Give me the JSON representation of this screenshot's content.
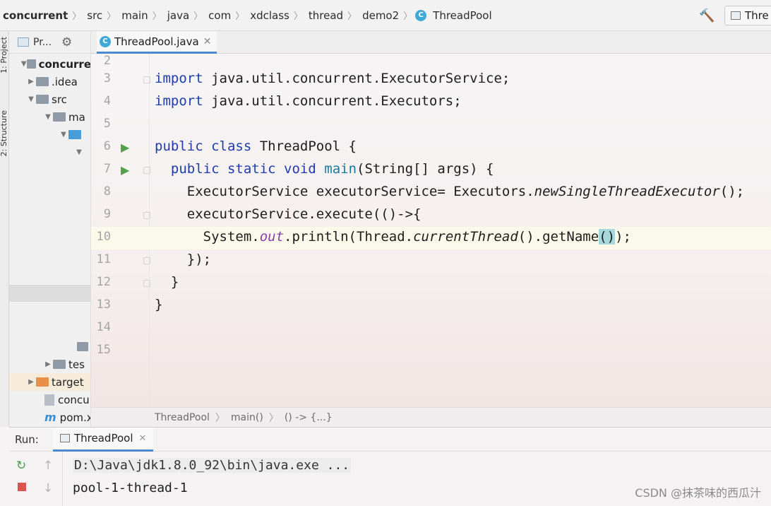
{
  "breadcrumb": [
    "concurrent",
    "src",
    "main",
    "java",
    "com",
    "xdclass",
    "thread",
    "demo2",
    "ThreadPool"
  ],
  "run_config": {
    "label": "Thre"
  },
  "tool_strip": {
    "project_tab": "1: Project",
    "structure_tab": "2: Structure"
  },
  "project_panel": {
    "header": "Pr...",
    "tree": [
      {
        "label": "concurre",
        "icon": "folder-icon",
        "arrow": "▼"
      },
      {
        "label": ".idea",
        "icon": "folder-icon",
        "arrow": "▶"
      },
      {
        "label": "src",
        "icon": "folder-icon",
        "arrow": "▼"
      },
      {
        "label": "ma",
        "icon": "folder-icon",
        "arrow": "▼"
      },
      {
        "label": "",
        "icon": "folder-blue-icon",
        "arrow": "▼"
      },
      {
        "label": "",
        "icon": "",
        "arrow": "▼"
      },
      {
        "label": "",
        "icon": "folder-icon",
        "arrow": ""
      },
      {
        "label": "tes",
        "icon": "folder-icon",
        "arrow": "▶"
      },
      {
        "label": "target",
        "icon": "folder-orange-icon",
        "arrow": "▶"
      },
      {
        "label": "concu",
        "icon": "file-icon",
        "arrow": ""
      },
      {
        "label": "pom.x",
        "icon": "maven-icon",
        "arrow": ""
      }
    ]
  },
  "editor": {
    "tab_label": "ThreadPool.java",
    "current_line": "10",
    "lines": [
      {
        "num": "2"
      },
      {
        "num": "3"
      },
      {
        "num": "4"
      },
      {
        "num": "5"
      },
      {
        "num": "6"
      },
      {
        "num": "7"
      },
      {
        "num": "8"
      },
      {
        "num": "9"
      },
      {
        "num": "10"
      },
      {
        "num": "11"
      },
      {
        "num": "12"
      },
      {
        "num": "13"
      },
      {
        "num": "14"
      },
      {
        "num": "15"
      }
    ],
    "code": {
      "l3_kw": "import",
      "l3_rest": " java.util.concurrent.ExecutorService;",
      "l4_kw": "import",
      "l4_rest": " java.util.concurrent.Executors;",
      "l6_kw": "public class",
      "l6_rest": " ThreadPool {",
      "l7_indent": "  ",
      "l7_kw": "public static void",
      "l7_sp": " ",
      "l7_method": "main",
      "l7_rest": "(String[] args) {",
      "l8_a": "    ExecutorService executorService= Executors.",
      "l8_b": "newSingleThreadExecutor",
      "l8_c": "();",
      "l9": "    executorService.execute(()->{",
      "l10_a": "      System.",
      "l10_b": "out",
      "l10_c": ".println(Thread.",
      "l10_d": "currentThread",
      "l10_e": "().getName",
      "l10_f": "()",
      "l10_g": ");",
      "l11": "    });",
      "l12": "  }",
      "l13": "}"
    },
    "breadcrumb": [
      "ThreadPool",
      "main()",
      "() -> {...}"
    ]
  },
  "run_panel": {
    "title": "Run:",
    "tab_label": "ThreadPool",
    "console": [
      "D:\\Java\\jdk1.8.0_92\\bin\\java.exe ...",
      "pool-1-thread-1"
    ]
  },
  "watermark": "CSDN @抹茶味的西瓜汁"
}
